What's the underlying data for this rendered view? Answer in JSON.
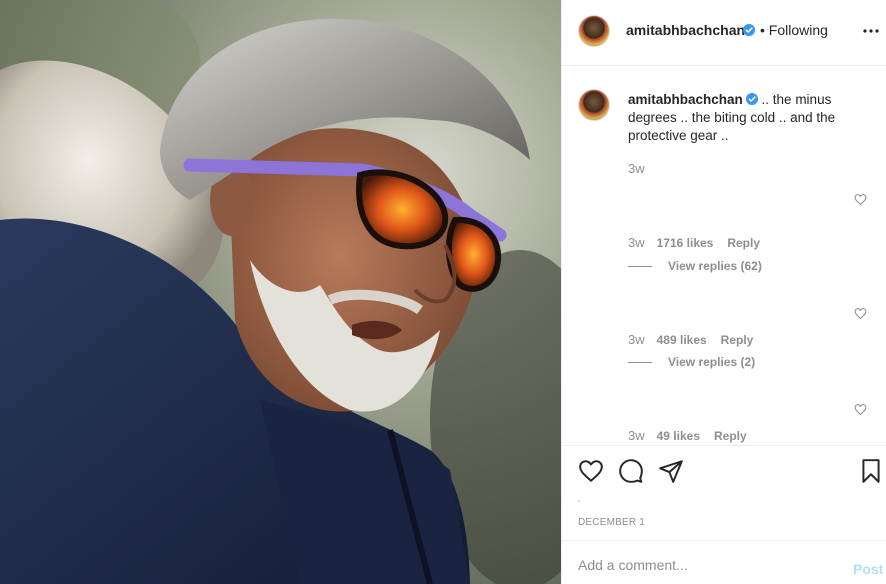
{
  "post": {
    "username": "amitabhbachchan",
    "follow_status": "• Following",
    "caption_text": ".. the minus degrees .. the biting cold .. and the protective gear ..",
    "caption_time": "3w",
    "date": "DECEMBER 1"
  },
  "comments": [
    {
      "time": "3w",
      "likes": "1716 likes",
      "reply": "Reply",
      "view_replies": "View replies (62)"
    },
    {
      "time": "3w",
      "likes": "489 likes",
      "reply": "Reply",
      "view_replies": "View replies (2)"
    },
    {
      "time": "3w",
      "likes": "49 likes",
      "reply": "Reply"
    }
  ],
  "add_comment": {
    "placeholder": "Add a comment...",
    "post_label": "Post"
  },
  "icons": {
    "more": "more-options-icon",
    "verified": "verified-badge-icon",
    "like": "heart-icon",
    "comment": "comment-bubble-icon",
    "share": "paper-plane-icon",
    "save": "bookmark-icon"
  },
  "colors": {
    "verified_blue": "#3897f0",
    "post_button_disabled": "#b2dffc",
    "secondary_text": "#8e8e8e"
  }
}
